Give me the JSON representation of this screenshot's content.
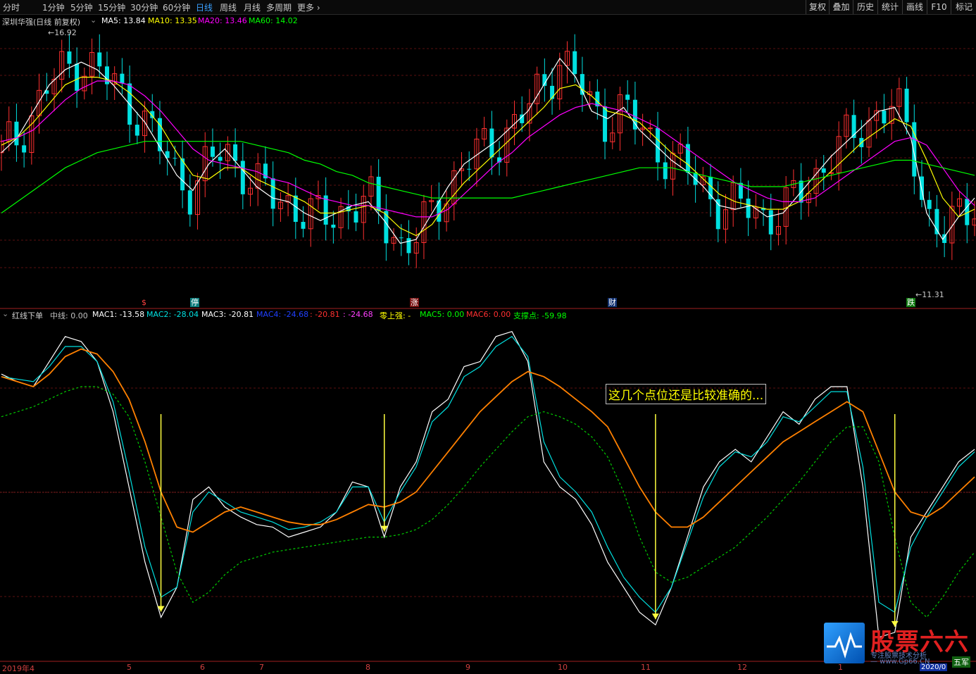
{
  "toolbar": {
    "periods": [
      "分时",
      "1分钟",
      "5分钟",
      "15分钟",
      "30分钟",
      "60分钟",
      "日线",
      "周线",
      "月线",
      "多周期",
      "更多"
    ],
    "active": "日线",
    "right_buttons": [
      "复权",
      "叠加",
      "历史",
      "统计",
      "画线",
      "F10",
      "标记"
    ]
  },
  "main_header": {
    "stock_name": "深圳华强(日线 前复权)",
    "ma5": "MA5: 13.84",
    "ma10": "MA10: 13.35",
    "ma20": "MA20: 13.46",
    "ma60": "MA60: 14.02",
    "colors": {
      "ma5": "#ffffff",
      "ma10": "#ffff00",
      "ma20": "#ff00ff",
      "ma60": "#00ff00"
    }
  },
  "price_labels": {
    "high": "16.92",
    "low": "11.31"
  },
  "markers": [
    "$",
    "停",
    "涨",
    "财",
    "跌"
  ],
  "indicator_header": {
    "name": "红线下单",
    "mid": "中线: 0.00",
    "mac1": "MAC1: -13.58",
    "mac2": "MAC2: -28.04",
    "mac3": "MAC3: -20.81",
    "mac4": "MAC4: -24.68",
    "mac4b": ": -20.81",
    "mac4c": ": -24.68",
    "zero_strong": "零上强: -",
    "mac5": "MAC5: 0.00",
    "mac6": "MAC6: 0.00",
    "support": "支撑点: -59.98"
  },
  "annotation": "这几个点位还是比较准确的...",
  "x_axis": {
    "labels": [
      "2019年4",
      "5",
      "6",
      "7",
      "8",
      "9",
      "10",
      "11",
      "12",
      "1"
    ],
    "corner": "五军",
    "date": "2020/0"
  },
  "watermark": {
    "title": "股票六六",
    "line1": "专注股票技术分析",
    "line2": "— www.Gp66.CN"
  },
  "chart_data": [
    {
      "type": "candlestick",
      "title": "深圳华强(日线 前复权)",
      "ylim": [
        10.5,
        17.5
      ],
      "annotations": [
        {
          "text": "16.92",
          "kind": "high"
        },
        {
          "text": "11.31",
          "kind": "low"
        }
      ],
      "series": [
        {
          "name": "MA5",
          "color": "#ffffff",
          "values": [
            14.2,
            14.6,
            15.3,
            16.0,
            16.4,
            16.6,
            16.4,
            16.0,
            15.5,
            15.0,
            14.3,
            13.6,
            13.2,
            13.9,
            14.3,
            13.8,
            13.3,
            13.0,
            12.9,
            12.6,
            12.4,
            12.6,
            12.8,
            12.9,
            12.4,
            11.8,
            11.9,
            12.6,
            13.3,
            13.9,
            14.2,
            14.5,
            14.9,
            15.3,
            16.0,
            16.7,
            16.2,
            15.3,
            15.1,
            15.4,
            14.8,
            14.4,
            14.0,
            13.7,
            13.3,
            12.8,
            12.7,
            12.8,
            12.5,
            12.6,
            13.1,
            13.6,
            14.1,
            14.5,
            14.9,
            15.3,
            15.4,
            14.6,
            12.6,
            11.9,
            12.5,
            13.0
          ]
        },
        {
          "name": "MA10",
          "color": "#ffff00",
          "values": [
            14.4,
            14.6,
            15.0,
            15.5,
            16.0,
            16.2,
            16.2,
            16.1,
            15.8,
            15.4,
            14.9,
            14.2,
            13.6,
            13.5,
            13.8,
            13.8,
            13.5,
            13.3,
            13.1,
            12.9,
            12.6,
            12.6,
            12.7,
            12.8,
            12.6,
            12.2,
            12.0,
            12.3,
            12.9,
            13.4,
            13.8,
            14.2,
            14.6,
            15.0,
            15.4,
            15.9,
            16.0,
            15.7,
            15.3,
            15.2,
            15.0,
            14.6,
            14.2,
            13.9,
            13.5,
            13.1,
            12.9,
            12.8,
            12.7,
            12.7,
            12.9,
            13.3,
            13.7,
            14.1,
            14.5,
            14.8,
            15.1,
            14.9,
            14.0,
            13.0,
            12.5,
            12.7
          ]
        },
        {
          "name": "MA20",
          "color": "#ff00ff",
          "values": [
            14.5,
            14.6,
            14.8,
            15.2,
            15.6,
            15.9,
            16.1,
            16.1,
            16.0,
            15.7,
            15.3,
            14.8,
            14.3,
            14.0,
            13.9,
            13.8,
            13.7,
            13.5,
            13.4,
            13.2,
            13.0,
            12.9,
            12.8,
            12.8,
            12.7,
            12.6,
            12.5,
            12.5,
            12.7,
            13.1,
            13.5,
            13.9,
            14.2,
            14.6,
            14.9,
            15.2,
            15.4,
            15.5,
            15.4,
            15.3,
            15.1,
            14.9,
            14.6,
            14.3,
            14.0,
            13.7,
            13.4,
            13.2,
            13.0,
            12.9,
            12.9,
            13.0,
            13.3,
            13.6,
            13.9,
            14.2,
            14.5,
            14.6,
            14.4,
            13.8,
            13.2,
            12.8
          ]
        },
        {
          "name": "MA60",
          "color": "#00ff00",
          "values": [
            12.6,
            12.9,
            13.2,
            13.5,
            13.8,
            14.0,
            14.2,
            14.3,
            14.4,
            14.5,
            14.5,
            14.5,
            14.5,
            14.5,
            14.5,
            14.5,
            14.4,
            14.3,
            14.2,
            14.0,
            13.9,
            13.7,
            13.6,
            13.4,
            13.3,
            13.2,
            13.1,
            13.0,
            13.0,
            13.0,
            13.0,
            13.0,
            13.0,
            13.1,
            13.2,
            13.3,
            13.4,
            13.5,
            13.6,
            13.7,
            13.8,
            13.8,
            13.8,
            13.7,
            13.6,
            13.5,
            13.4,
            13.3,
            13.3,
            13.3,
            13.4,
            13.5,
            13.6,
            13.7,
            13.8,
            13.9,
            14.0,
            14.0,
            13.9,
            13.8,
            13.7,
            13.6
          ]
        }
      ]
    },
    {
      "type": "line",
      "title": "红线下单",
      "ylim": [
        -80,
        45
      ],
      "annotations": [
        {
          "text": "这几个点位还是比较准确的..."
        }
      ],
      "series": [
        {
          "name": "MAC1",
          "color": "#ffffff",
          "values": [
            25,
            22,
            20,
            30,
            40,
            38,
            30,
            10,
            -20,
            -50,
            -72,
            -60,
            -25,
            -20,
            -28,
            -32,
            -35,
            -36,
            -40,
            -38,
            -36,
            -30,
            -18,
            -20,
            -40,
            -20,
            -10,
            10,
            15,
            28,
            30,
            40,
            42,
            30,
            -10,
            -20,
            -25,
            -35,
            -50,
            -60,
            -70,
            -75,
            -60,
            -40,
            -20,
            -10,
            -5,
            -10,
            0,
            10,
            5,
            15,
            20,
            20,
            -20,
            -80,
            -78,
            -40,
            -30,
            -20,
            -10,
            -5
          ]
        },
        {
          "name": "MAC2",
          "color": "#00e0e0",
          "values": [
            24,
            23,
            22,
            28,
            36,
            36,
            30,
            14,
            -14,
            -44,
            -64,
            -60,
            -30,
            -22,
            -26,
            -30,
            -32,
            -34,
            -37,
            -36,
            -34,
            -30,
            -20,
            -20,
            -34,
            -22,
            -12,
            6,
            12,
            24,
            28,
            36,
            40,
            32,
            -2,
            -16,
            -22,
            -30,
            -44,
            -56,
            -64,
            -70,
            -60,
            -42,
            -24,
            -12,
            -6,
            -8,
            -2,
            8,
            6,
            12,
            18,
            18,
            -12,
            -66,
            -70,
            -44,
            -32,
            -22,
            -12,
            -6
          ]
        },
        {
          "name": "MAC3",
          "color": "#ff8000",
          "values": [
            24,
            22,
            20,
            25,
            32,
            35,
            33,
            26,
            15,
            -2,
            -22,
            -36,
            -38,
            -34,
            -30,
            -28,
            -30,
            -32,
            -34,
            -35,
            -35,
            -33,
            -30,
            -27,
            -28,
            -26,
            -22,
            -14,
            -6,
            2,
            10,
            16,
            22,
            26,
            24,
            20,
            15,
            10,
            4,
            -8,
            -20,
            -30,
            -36,
            -36,
            -32,
            -26,
            -20,
            -14,
            -8,
            -2,
            2,
            6,
            10,
            14,
            10,
            -6,
            -22,
            -30,
            -32,
            -28,
            -22,
            -16
          ]
        },
        {
          "name": "MAC4",
          "color": "#00cc00",
          "values": [
            8,
            10,
            12,
            15,
            18,
            20,
            20,
            17,
            8,
            -10,
            -32,
            -54,
            -66,
            -62,
            -55,
            -50,
            -48,
            -46,
            -45,
            -44,
            -43,
            -42,
            -41,
            -40,
            -40,
            -39,
            -37,
            -33,
            -27,
            -20,
            -12,
            -5,
            2,
            8,
            10,
            8,
            5,
            0,
            -8,
            -22,
            -40,
            -54,
            -58,
            -56,
            -52,
            -48,
            -44,
            -38,
            -32,
            -25,
            -18,
            -10,
            -2,
            4,
            4,
            -10,
            -40,
            -66,
            -72,
            -64,
            -54,
            -46
          ]
        }
      ]
    }
  ]
}
